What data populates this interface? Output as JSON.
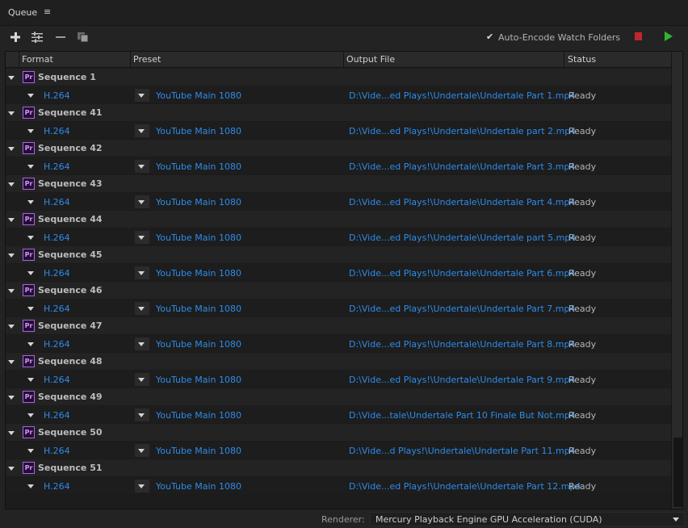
{
  "panel": {
    "tab_title": "Queue",
    "tab_menu": "≡"
  },
  "toolbar": {
    "add_icon": "plus-icon",
    "settings_icon": "settings-icon",
    "remove_icon": "minus-icon",
    "duplicate_icon": "duplicate-icon",
    "auto_encode_label": "Auto-Encode Watch Folders",
    "auto_encode_checked": true,
    "stop_color": "#c0272d",
    "start_color": "#2fb62f"
  },
  "columns": {
    "format": "Format",
    "preset": "Preset",
    "output": "Output File",
    "status": "Status"
  },
  "queue": [
    {
      "sequence": "Sequence 1",
      "format": "H.264",
      "preset": "YouTube Main 1080",
      "output": "D:\\Vide...ed Plays!\\Undertale\\Undertale Part 1.mp4",
      "status": "Ready"
    },
    {
      "sequence": "Sequence 41",
      "format": "H.264",
      "preset": "YouTube Main 1080",
      "output": "D:\\Vide...ed Plays!\\Undertale\\Undertale part 2.mp4",
      "status": "Ready"
    },
    {
      "sequence": "Sequence 42",
      "format": "H.264",
      "preset": "YouTube Main 1080",
      "output": "D:\\Vide...ed Plays!\\Undertale\\Undertale Part 3.mp4",
      "status": "Ready"
    },
    {
      "sequence": "Sequence 43",
      "format": "H.264",
      "preset": "YouTube Main 1080",
      "output": "D:\\Vide...ed Plays!\\Undertale\\Undertale Part 4.mp4",
      "status": "Ready"
    },
    {
      "sequence": "Sequence 44",
      "format": "H.264",
      "preset": "YouTube Main 1080",
      "output": "D:\\Vide...ed Plays!\\Undertale\\Undertale part 5.mp4",
      "status": "Ready"
    },
    {
      "sequence": "Sequence 45",
      "format": "H.264",
      "preset": "YouTube Main 1080",
      "output": "D:\\Vide...ed Plays!\\Undertale\\Undertale Part 6.mp4",
      "status": "Ready"
    },
    {
      "sequence": "Sequence 46",
      "format": "H.264",
      "preset": "YouTube Main 1080",
      "output": "D:\\Vide...ed Plays!\\Undertale\\Undertale Part 7.mp4",
      "status": "Ready"
    },
    {
      "sequence": "Sequence 47",
      "format": "H.264",
      "preset": "YouTube Main 1080",
      "output": "D:\\Vide...ed Plays!\\Undertale\\Undertale Part 8.mp4",
      "status": "Ready"
    },
    {
      "sequence": "Sequence 48",
      "format": "H.264",
      "preset": "YouTube Main 1080",
      "output": "D:\\Vide...ed Plays!\\Undertale\\Undertale Part 9.mp4",
      "status": "Ready"
    },
    {
      "sequence": "Sequence 49",
      "format": "H.264",
      "preset": "YouTube Main 1080",
      "output": "D:\\Vide...tale\\Undertale Part 10 Finale But Not.mp4",
      "status": "Ready"
    },
    {
      "sequence": "Sequence 50",
      "format": "H.264",
      "preset": "YouTube Main 1080",
      "output": "D:\\Vide...d Plays!\\Undertale\\Undertale Part 11.mp4",
      "status": "Ready"
    },
    {
      "sequence": "Sequence 51",
      "format": "H.264",
      "preset": "YouTube Main 1080",
      "output": "D:\\Vide...ed Plays!\\Undertale\\Undertale Part 12.mp4",
      "status": "Ready"
    }
  ],
  "footer": {
    "renderer_label": "Renderer:",
    "renderer_value": "Mercury Playback Engine GPU Acceleration (CUDA)"
  }
}
